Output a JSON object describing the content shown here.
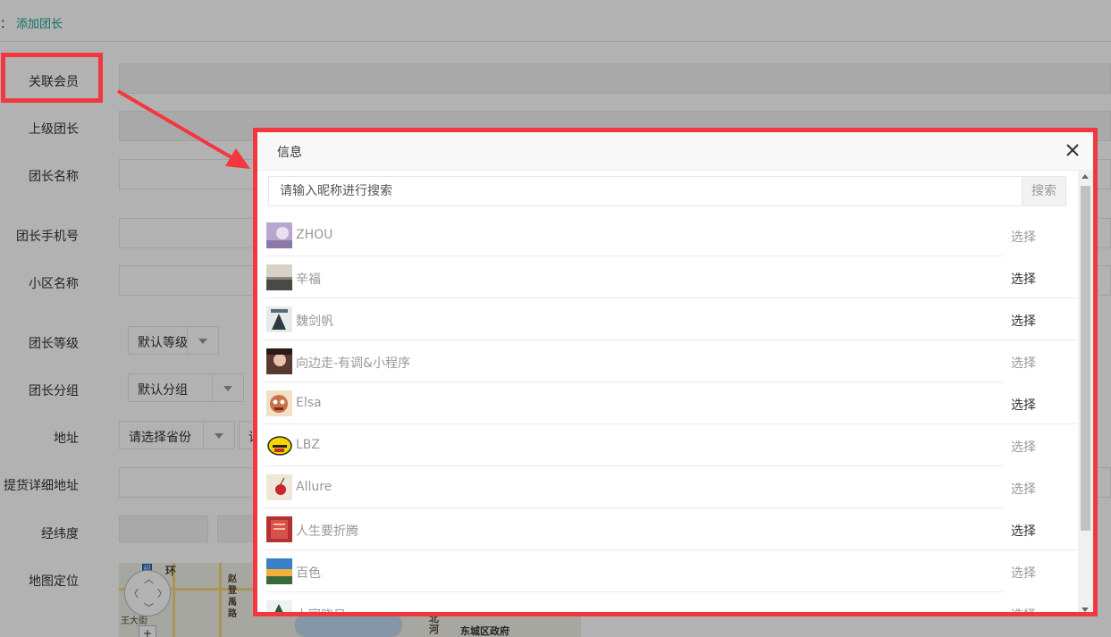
{
  "breadcrumb": {
    "separator": "：",
    "current": "添加团长"
  },
  "form": {
    "member_label": "关联会员",
    "parent_label": "上级团长",
    "name_label": "团长名称",
    "phone_label": "团长手机号",
    "community_label": "小区名称",
    "level_label": "团长等级",
    "level_value": "默认等级",
    "group_label": "团长分组",
    "group_value": "默认分组",
    "address_label": "地址",
    "province_placeholder": "请选择省份",
    "city_partial": "请",
    "pickup_label": "提货详细地址",
    "latlng_label": "经纬度",
    "map_label": "地图定位"
  },
  "map": {
    "poi1": "环",
    "poi2": "赵登禹路",
    "poi3": "王大街",
    "poi4": "北河",
    "poi5": "东城区政府"
  },
  "modal": {
    "title": "信息",
    "search_placeholder": "请输入昵称进行搜索",
    "search_button": "搜索",
    "choose_label": "选择",
    "rows": [
      {
        "nickname": "ZHOU",
        "avatar": "avatar-purple",
        "choose_style": "dim"
      },
      {
        "nickname": "辛福",
        "avatar": "avatar-dark-landscape",
        "choose_style": "dark"
      },
      {
        "nickname": "魏剑帆",
        "avatar": "avatar-poster",
        "choose_style": "dark"
      },
      {
        "nickname": "向边走-有调&小程序",
        "avatar": "avatar-portrait",
        "choose_style": "dim"
      },
      {
        "nickname": "Elsa",
        "avatar": "avatar-cartoon-face",
        "choose_style": "dark"
      },
      {
        "nickname": "LBZ",
        "avatar": "avatar-yellow-emoji",
        "choose_style": "dim"
      },
      {
        "nickname": "Allure",
        "avatar": "avatar-cherry",
        "choose_style": "dim"
      },
      {
        "nickname": "人生要折腾",
        "avatar": "avatar-red-card",
        "choose_style": "dark"
      },
      {
        "nickname": "百色",
        "avatar": "avatar-sunset",
        "choose_style": "dim"
      },
      {
        "nickname": "上官晓日",
        "avatar": "avatar-tree",
        "choose_style": "dim"
      }
    ]
  },
  "colors": {
    "highlight": "#f2373e",
    "link": "#1aa094",
    "shade": "rgba(0,0,0,0.30)"
  }
}
